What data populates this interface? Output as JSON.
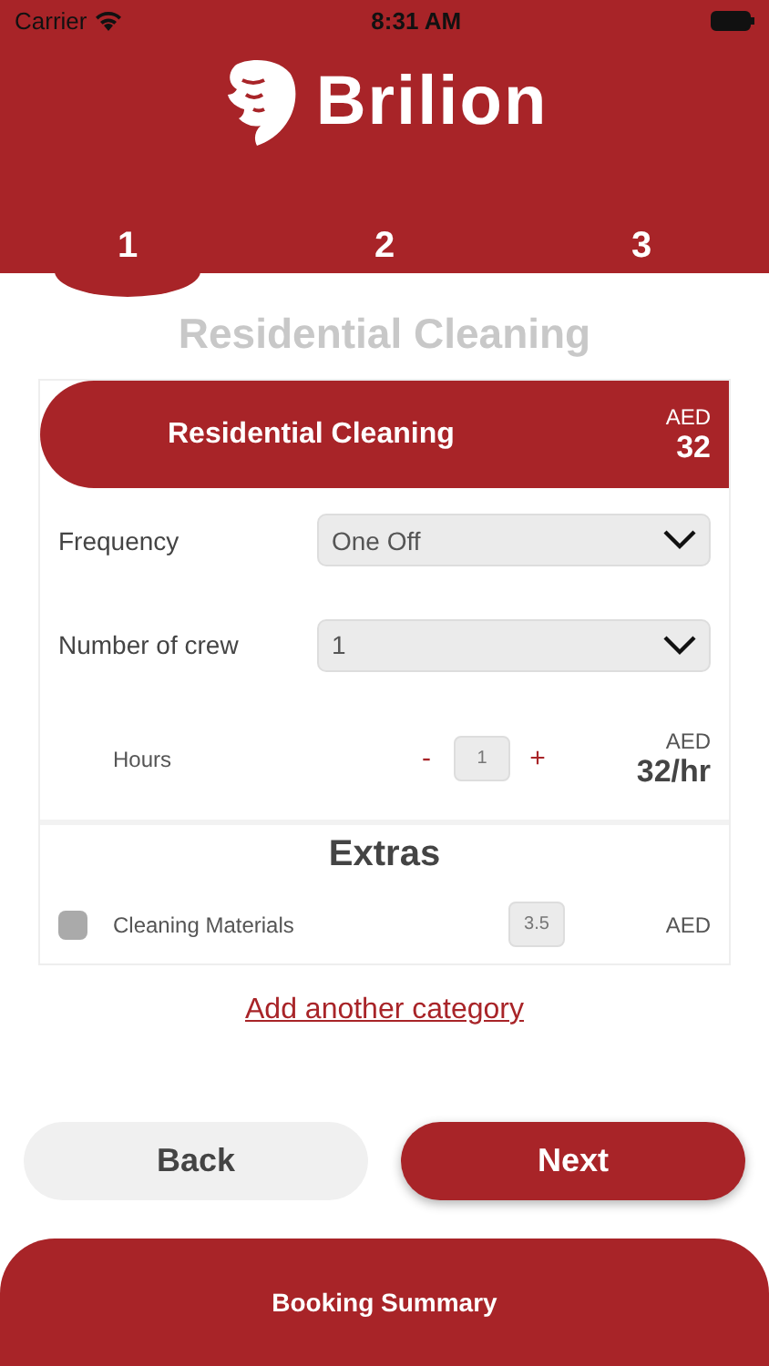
{
  "status_bar": {
    "carrier": "Carrier",
    "time": "8:31 AM"
  },
  "brand": {
    "name": "Brilion"
  },
  "steps": [
    {
      "label": "1",
      "selected": true
    },
    {
      "label": "2",
      "selected": false
    },
    {
      "label": "3",
      "selected": false
    }
  ],
  "page_title": "Residential Cleaning",
  "service": {
    "name": "Residential Cleaning",
    "currency": "AED",
    "price": "32",
    "fields": [
      {
        "label": "Frequency",
        "value": "One Off"
      },
      {
        "label": "Number of crew",
        "value": "1"
      }
    ],
    "hours": {
      "label": "Hours",
      "minus": "-",
      "value": "1",
      "plus": "+",
      "currency": "AED",
      "rate": "32/hr"
    },
    "extras_title": "Extras",
    "extras": [
      {
        "label": "Cleaning Materials",
        "checked": false,
        "value": "3.5",
        "currency": "AED"
      }
    ]
  },
  "add_link": "Add another category",
  "buttons": [
    {
      "label": "Back",
      "kind": "secondary"
    },
    {
      "label": "Next",
      "kind": "primary"
    }
  ],
  "summary": {
    "label": "Booking Summary"
  }
}
